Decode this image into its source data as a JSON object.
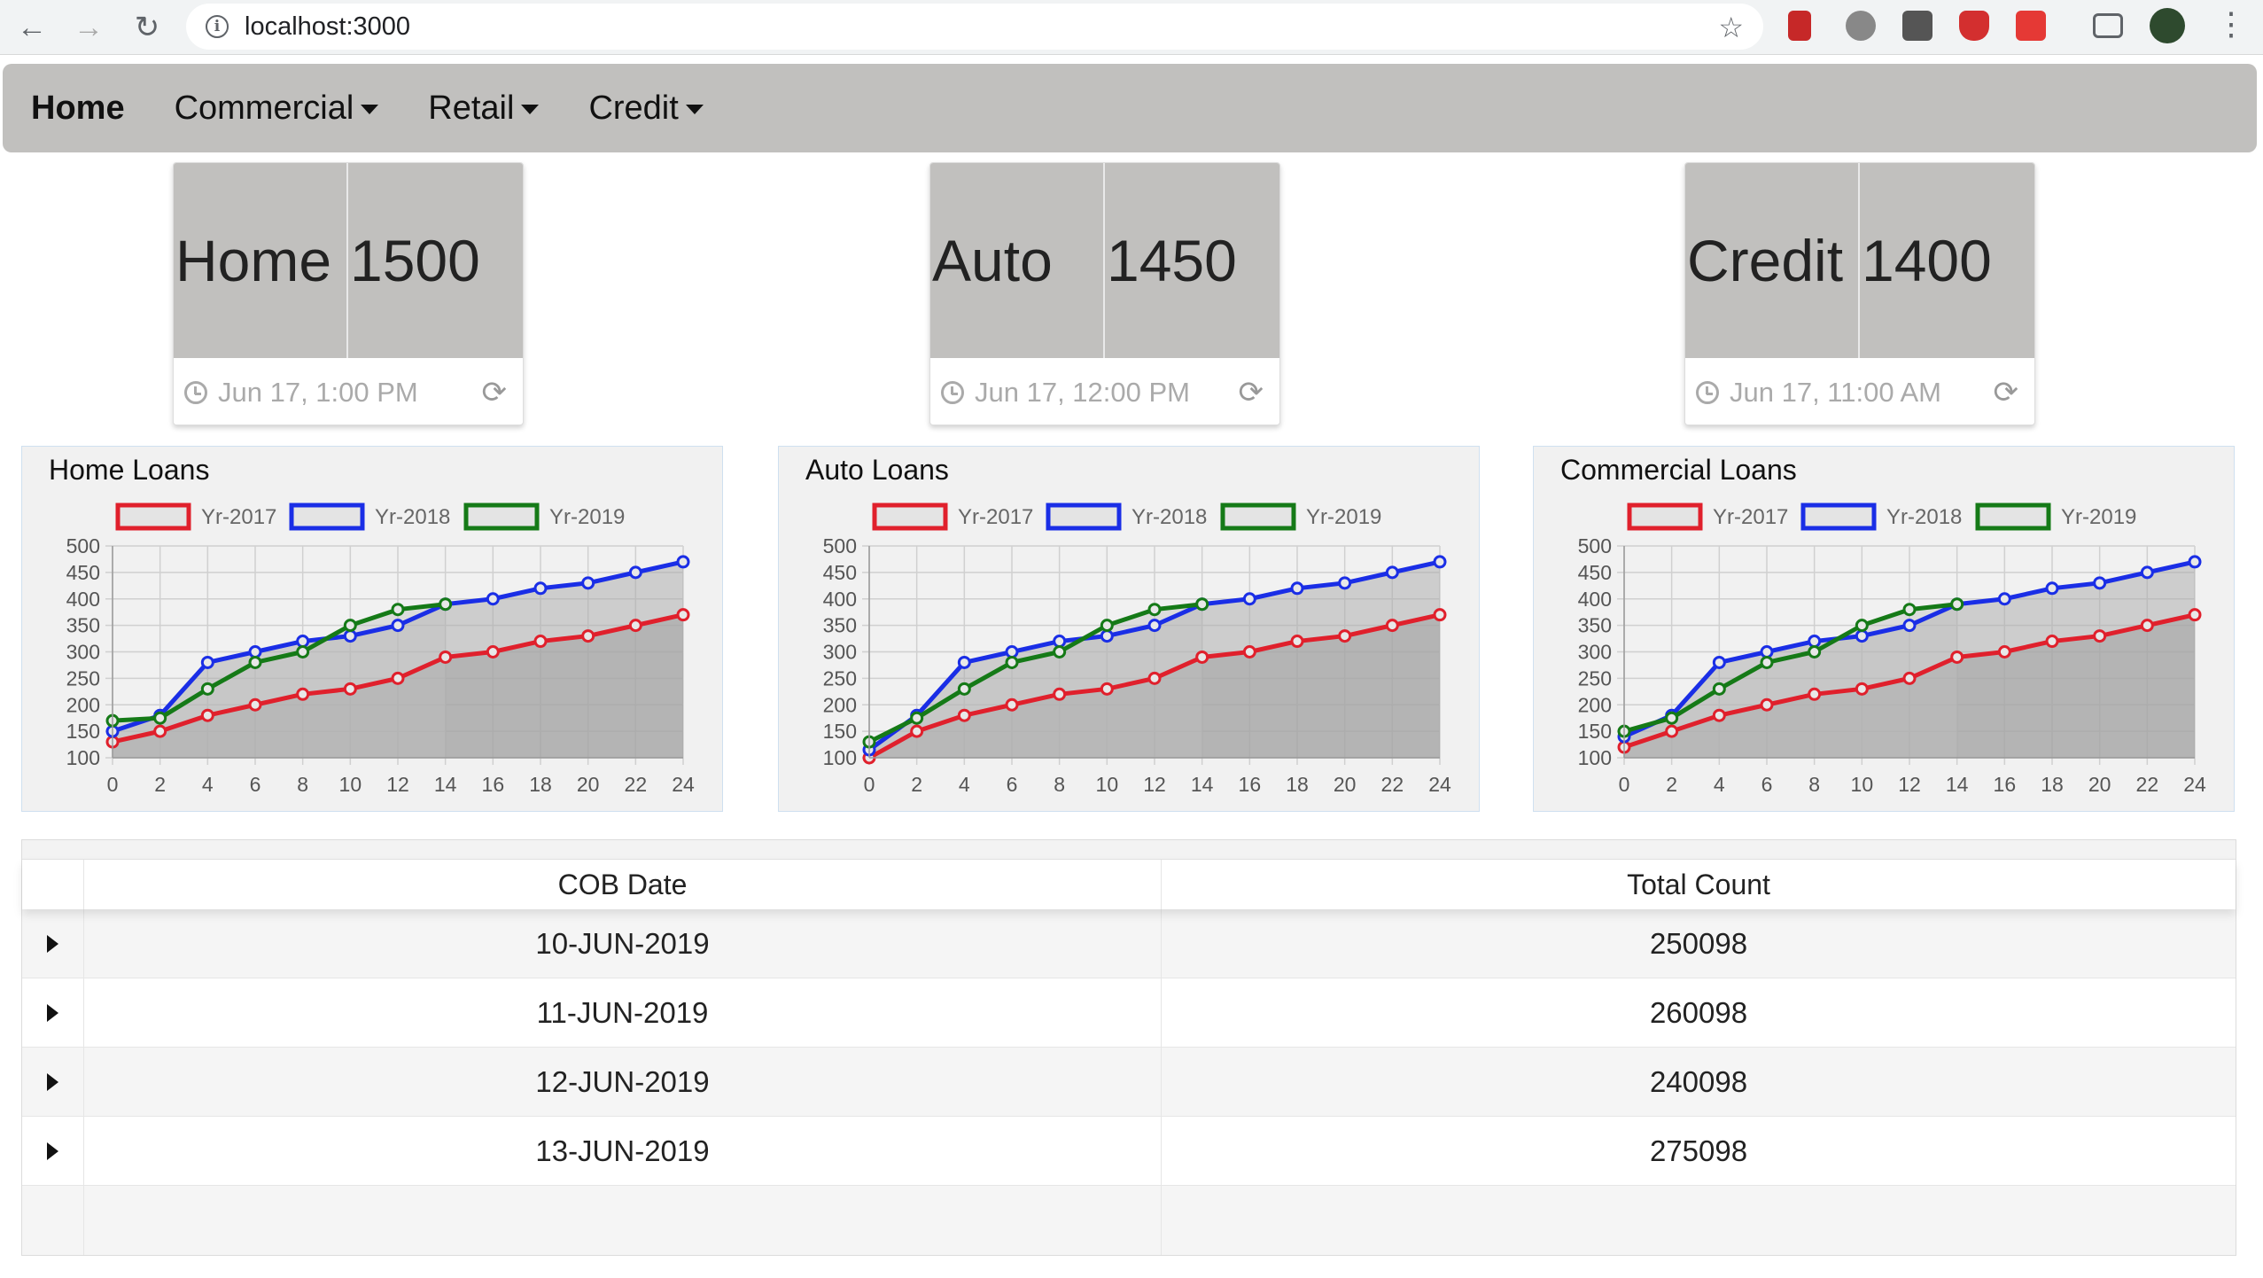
{
  "browser": {
    "url": "localhost:3000"
  },
  "navbar": {
    "items": [
      {
        "label": "Home",
        "dropdown": false,
        "active": true
      },
      {
        "label": "Commercial",
        "dropdown": true
      },
      {
        "label": "Retail",
        "dropdown": true
      },
      {
        "label": "Credit",
        "dropdown": true
      }
    ]
  },
  "stats": [
    {
      "label": "Home",
      "value": "1500",
      "time": "Jun 17, 1:00 PM"
    },
    {
      "label": "Auto",
      "value": "1450",
      "time": "Jun 17, 12:00 PM"
    },
    {
      "label": "Credit",
      "value": "1400",
      "time": "Jun 17, 11:00 AM"
    }
  ],
  "colors": {
    "yr2017": "#e0202c",
    "yr2018": "#1a2ee6",
    "yr2019": "#157a17",
    "nav_bg": "#c1c0be"
  },
  "chart_data": [
    {
      "type": "area",
      "title": "Home Loans",
      "x": [
        0,
        2,
        4,
        6,
        8,
        10,
        12,
        14,
        16,
        18,
        20,
        22,
        24
      ],
      "xticks": [
        0,
        2,
        4,
        6,
        8,
        10,
        12,
        14,
        16,
        18,
        20,
        22,
        24
      ],
      "ylim": [
        100,
        500
      ],
      "yticks": [
        100,
        150,
        200,
        250,
        300,
        350,
        400,
        450,
        500
      ],
      "legend_position": "top",
      "grid": true,
      "series": [
        {
          "name": "Yr-2017",
          "values": [
            130,
            150,
            180,
            200,
            220,
            230,
            250,
            290,
            300,
            320,
            330,
            350,
            370
          ]
        },
        {
          "name": "Yr-2018",
          "values": [
            150,
            180,
            280,
            300,
            320,
            330,
            350,
            390,
            400,
            420,
            430,
            450,
            470
          ]
        },
        {
          "name": "Yr-2019",
          "values": [
            170,
            175,
            230,
            280,
            300,
            350,
            380,
            390,
            null,
            null,
            null,
            null,
            null
          ]
        }
      ]
    },
    {
      "type": "area",
      "title": "Auto Loans",
      "x": [
        0,
        2,
        4,
        6,
        8,
        10,
        12,
        14,
        16,
        18,
        20,
        22,
        24
      ],
      "xticks": [
        0,
        2,
        4,
        6,
        8,
        10,
        12,
        14,
        16,
        18,
        20,
        22,
        24
      ],
      "ylim": [
        100,
        500
      ],
      "yticks": [
        100,
        150,
        200,
        250,
        300,
        350,
        400,
        450,
        500
      ],
      "legend_position": "top",
      "grid": true,
      "series": [
        {
          "name": "Yr-2017",
          "values": [
            100,
            150,
            180,
            200,
            220,
            230,
            250,
            290,
            300,
            320,
            330,
            350,
            370
          ]
        },
        {
          "name": "Yr-2018",
          "values": [
            115,
            180,
            280,
            300,
            320,
            330,
            350,
            390,
            400,
            420,
            430,
            450,
            470
          ]
        },
        {
          "name": "Yr-2019",
          "values": [
            130,
            175,
            230,
            280,
            300,
            350,
            380,
            390,
            null,
            null,
            null,
            null,
            null
          ]
        }
      ]
    },
    {
      "type": "area",
      "title": "Commercial Loans",
      "x": [
        0,
        2,
        4,
        6,
        8,
        10,
        12,
        14,
        16,
        18,
        20,
        22,
        24
      ],
      "xticks": [
        0,
        2,
        4,
        6,
        8,
        10,
        12,
        14,
        16,
        18,
        20,
        22,
        24
      ],
      "ylim": [
        100,
        500
      ],
      "yticks": [
        100,
        150,
        200,
        250,
        300,
        350,
        400,
        450,
        500
      ],
      "legend_position": "top",
      "grid": true,
      "series": [
        {
          "name": "Yr-2017",
          "values": [
            120,
            150,
            180,
            200,
            220,
            230,
            250,
            290,
            300,
            320,
            330,
            350,
            370
          ]
        },
        {
          "name": "Yr-2018",
          "values": [
            140,
            180,
            280,
            300,
            320,
            330,
            350,
            390,
            400,
            420,
            430,
            450,
            470
          ]
        },
        {
          "name": "Yr-2019",
          "values": [
            150,
            175,
            230,
            280,
            300,
            350,
            380,
            390,
            null,
            null,
            null,
            null,
            null
          ]
        }
      ]
    }
  ],
  "table": {
    "headers": {
      "date": "COB Date",
      "count": "Total Count"
    },
    "rows": [
      {
        "date": "10-JUN-2019",
        "count": "250098"
      },
      {
        "date": "11-JUN-2019",
        "count": "260098"
      },
      {
        "date": "12-JUN-2019",
        "count": "240098"
      },
      {
        "date": "13-JUN-2019",
        "count": "275098"
      }
    ]
  }
}
